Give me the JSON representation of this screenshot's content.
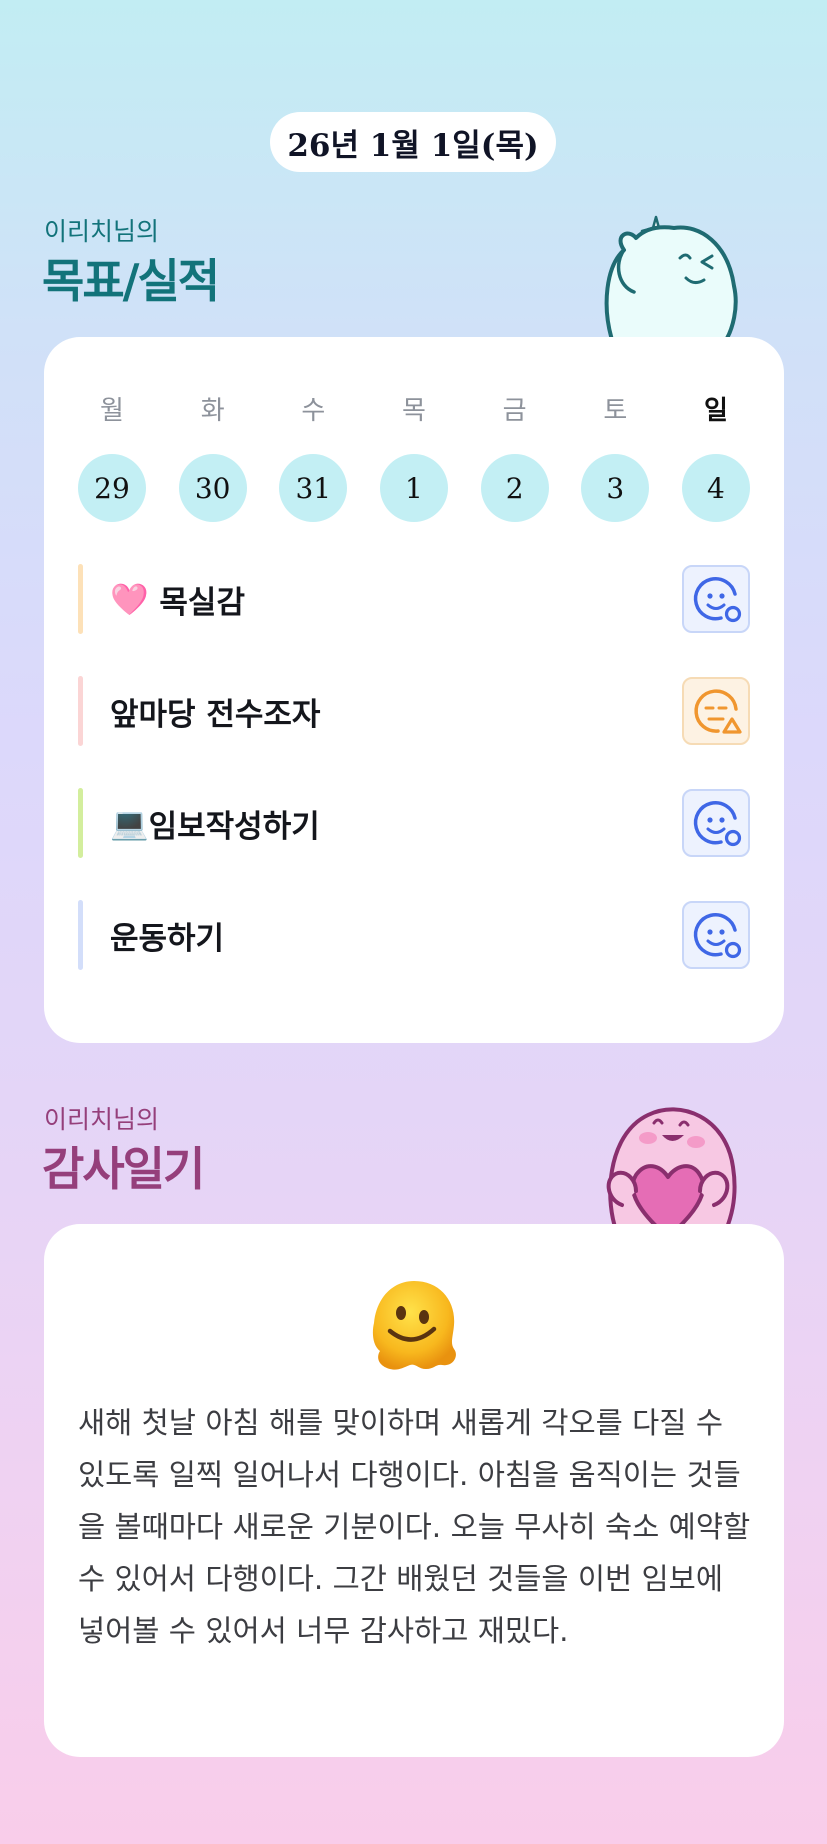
{
  "date_pill": "26년 1월 1일(목)",
  "goals_section": {
    "subtitle": "이리치님의",
    "title": "목표/실적",
    "weekdays": [
      "월",
      "화",
      "수",
      "목",
      "금",
      "토",
      "일"
    ],
    "days": [
      "29",
      "30",
      "31",
      "1",
      "2",
      "3",
      "4"
    ],
    "goals": [
      {
        "emoji": "🩷",
        "label": "목실감",
        "bar_color": "#fde1b8",
        "status": "good",
        "status_icon": "smiley-circle-icon"
      },
      {
        "emoji": "",
        "label": "앞마당 전수조자",
        "bar_color": "#fbd5d5",
        "status": "partial",
        "status_icon": "neutral-triangle-icon"
      },
      {
        "emoji": "💻",
        "label": "임보작성하기",
        "bar_color": "#d3ee9d",
        "status": "good",
        "status_icon": "smiley-circle-icon"
      },
      {
        "emoji": "",
        "label": "운동하기",
        "bar_color": "#d3defa",
        "status": "good",
        "status_icon": "smiley-circle-icon"
      }
    ]
  },
  "gratitude_section": {
    "subtitle": "이리치님의",
    "title": "감사일기",
    "emoji_icon": "melting-face-icon",
    "text": "새해 첫날 아침 해를 맞이하며 새롭게 각오를 다질 수 있도록 일찍 일어나서 다행이다. 아침을 움직이는 것들을 볼때마다 새로운 기분이다. 오늘 무사히 숙소 예약할 수 있어서 다행이다. 그간 배웠던 것들을 이번 임보에 넣어볼 수 있어서 너무 감사하고 재밌다."
  },
  "colors": {
    "goals_title": "#12737a",
    "gratitude_title": "#953f7b",
    "day_circle": "#c3eff4",
    "status_good": "#3f67e6",
    "status_partial": "#f0962f"
  }
}
